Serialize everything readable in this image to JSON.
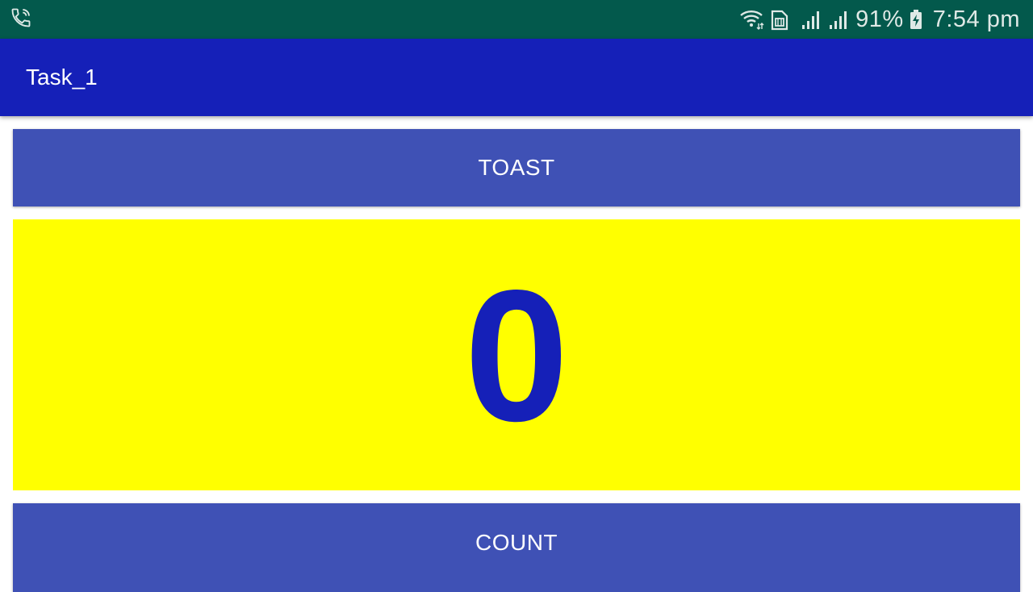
{
  "status_bar": {
    "call_icon": "phone-call-icon",
    "wifi_icon": "wifi-icon",
    "sim_icon": "sim-card-icon",
    "signal_icon_1": "signal-strength-icon",
    "signal_icon_2": "signal-strength-icon",
    "battery_percent": "91%",
    "battery_icon": "battery-charging-icon",
    "time": "7:54 pm",
    "background_color": "#03594c"
  },
  "app_bar": {
    "title": "Task_1",
    "background_color": "#1520b8"
  },
  "toast_button": {
    "label": "TOAST",
    "color": "#3f51b5"
  },
  "counter": {
    "value": "0",
    "background_color": "#ffff00",
    "text_color": "#1520b8"
  },
  "count_button": {
    "label": "COUNT",
    "color": "#3f51b5"
  }
}
